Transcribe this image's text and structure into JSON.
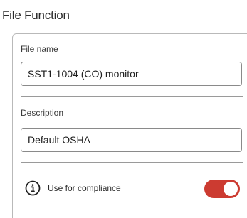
{
  "section": {
    "title": "File Function"
  },
  "file_name": {
    "label": "File name",
    "value": "SST1-1004 (CO) monitor"
  },
  "description": {
    "label": "Description",
    "value": "Default OSHA"
  },
  "compliance": {
    "label": "Use for compliance",
    "icon": "info-icon",
    "enabled": true,
    "toggle_color": "#cc3b31"
  }
}
